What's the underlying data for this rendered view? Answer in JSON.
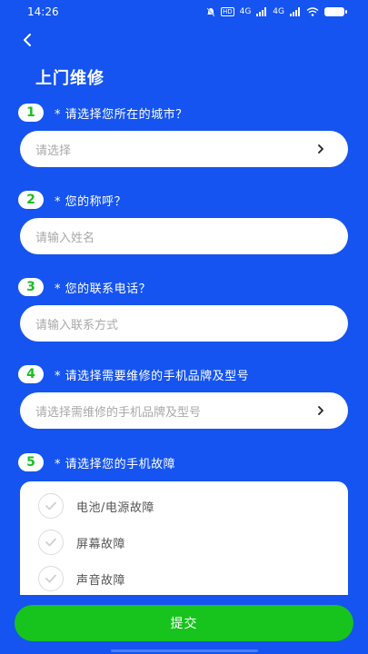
{
  "status_bar": {
    "time": "14:26",
    "network_1": "4G",
    "network_2": "4G",
    "hd_label": "HD"
  },
  "header": {
    "title": "上门维修"
  },
  "questions": [
    {
      "step": "1",
      "label": "* 请选择您所在的城市？",
      "placeholder": "请选择",
      "has_chevron": true
    },
    {
      "step": "2",
      "label": "* 您的称呼？",
      "placeholder": "请输入姓名",
      "has_chevron": false
    },
    {
      "step": "3",
      "label": "* 您的联系电话？",
      "placeholder": "请输入联系方式",
      "has_chevron": false
    },
    {
      "step": "4",
      "label": "* 请选择需要维修的手机品牌及型号",
      "placeholder": "请选择需维修的手机品牌及型号",
      "has_chevron": true
    },
    {
      "step": "5",
      "label": "* 请选择您的手机故障"
    }
  ],
  "faults": [
    {
      "label": "电池/电源故障"
    },
    {
      "label": "屏幕故障"
    },
    {
      "label": "声音故障"
    }
  ],
  "submit": {
    "label": "提交"
  },
  "colors": {
    "background": "#1554f0",
    "accent_green": "#17c41d",
    "badge_text": "#18c020"
  }
}
